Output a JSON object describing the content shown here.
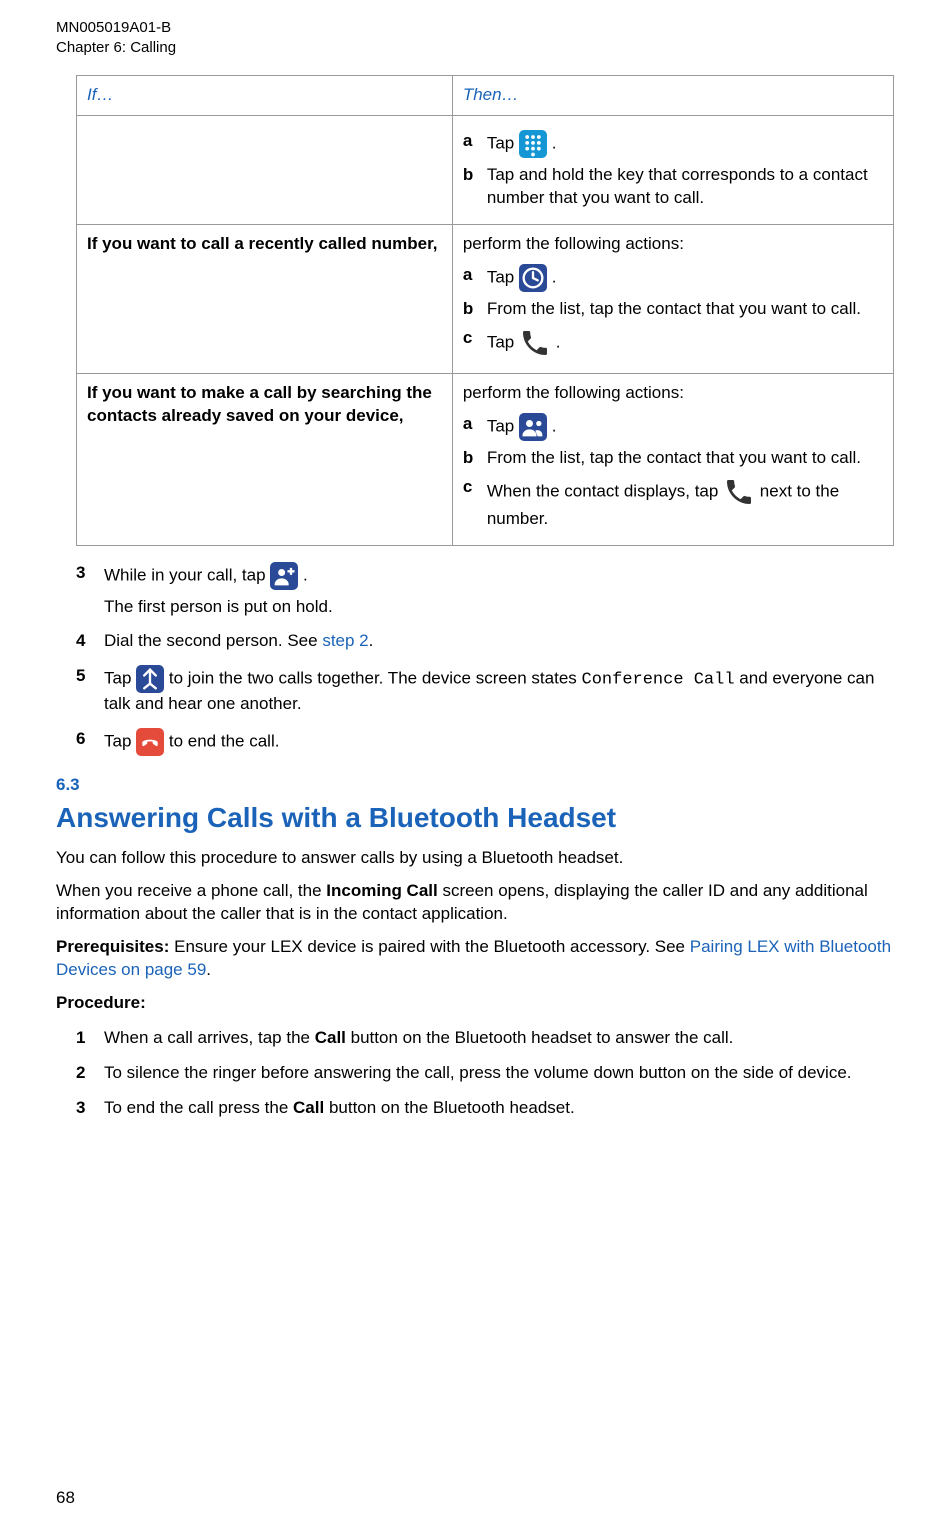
{
  "header": {
    "doc_id": "MN005019A01-B",
    "chapter": "Chapter 6:  Calling"
  },
  "table": {
    "headers": {
      "if": "If…",
      "then": "Then…"
    },
    "rows": [
      {
        "if": "",
        "then": [
          {
            "label": "a",
            "pre": "Tap ",
            "post": " ."
          },
          {
            "label": "b",
            "text": "Tap and hold the key that corresponds to a contact number that you want to call."
          }
        ]
      },
      {
        "if": "If you want to call a recently called number,",
        "intro": "perform the following actions:",
        "then": [
          {
            "label": "a",
            "pre": "Tap ",
            "post": "."
          },
          {
            "label": "b",
            "text": "From the list, tap the contact that you want to call."
          },
          {
            "label": "c",
            "pre": "Tap ",
            "post": " ."
          }
        ]
      },
      {
        "if": "If you want to make a call by searching the contacts already saved on your device,",
        "intro": "perform the following actions:",
        "then": [
          {
            "label": "a",
            "pre": "Tap ",
            "post": "."
          },
          {
            "label": "b",
            "text": "From the list, tap the contact that you want to call."
          },
          {
            "label": "c",
            "pre": "When the contact displays, tap ",
            "post": " next to the number."
          }
        ]
      }
    ]
  },
  "steps": [
    {
      "num": "3",
      "line1_pre": "While in your call, tap ",
      "line1_post": ".",
      "line2": "The first person is put on hold."
    },
    {
      "num": "4",
      "pre": "Dial the second person. See ",
      "link": "step 2",
      "post": "."
    },
    {
      "num": "5",
      "pre": "Tap ",
      "mid": " to join the two calls together. The device screen states ",
      "mono": "Conference Call",
      "post": " and everyone can talk and hear one another."
    },
    {
      "num": "6",
      "pre": "Tap ",
      "post": " to end the call."
    }
  ],
  "section": {
    "number": "6.3",
    "title": "Answering Calls with a Bluetooth Headset",
    "p1": "You can follow this procedure to answer calls by using a Bluetooth headset.",
    "p2_pre": "When you receive a phone call, the ",
    "p2_bold": "Incoming Call",
    "p2_post": " screen opens, displaying the caller ID and any additional information about the caller that is in the contact application.",
    "prereq_label": "Prerequisites: ",
    "prereq_text": "Ensure your LEX device is paired with the Bluetooth accessory. See ",
    "prereq_link": "Pairing LEX with Bluetooth Devices on page 59",
    "prereq_post": ".",
    "procedure_label": "Procedure:",
    "steps": [
      {
        "num": "1",
        "pre": "When a call arrives, tap the ",
        "bold": "Call",
        "post": " button on the Bluetooth headset to answer the call."
      },
      {
        "num": "2",
        "text": "To silence the ringer before answering the call, press the volume down button on the side of device."
      },
      {
        "num": "3",
        "pre": "To end the call press the ",
        "bold": "Call",
        "post": " button on the Bluetooth headset."
      }
    ]
  },
  "page_number": "68"
}
